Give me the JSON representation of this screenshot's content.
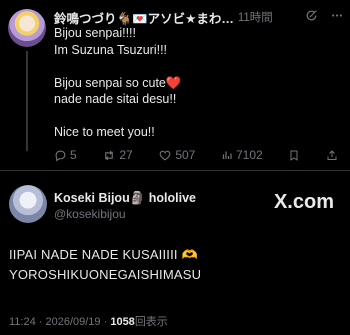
{
  "reply": {
    "display_name": "鈴鳴つづり🐐💌アソビ★まわ…",
    "time": "11時間",
    "lines": [
      "Bijou senpai!!!!",
      "Im Suzuna Tsuzuri!!!",
      "",
      "Bijou senpai so cute❤️",
      "nade nade sitai desu!!",
      "",
      "Nice to meet you!!"
    ],
    "stats": {
      "replies": "5",
      "reposts": "27",
      "likes": "507",
      "views": "7102"
    }
  },
  "quoted": {
    "display_name": "Koseki Bijou🗿 hololive",
    "handle": "@kosekibijou",
    "brand": "X.com",
    "lines": [
      "IIPAI NADE NADE KUSAIIIII 🫶",
      "YOROSHIKUONEGAISHIMASU"
    ],
    "footer_time": "11:24 · 2026/09/19 · ",
    "footer_count": "1058",
    "footer_suffix": "回表示"
  },
  "colors": {
    "background": "#000000",
    "text": "#e7e9ea",
    "muted": "#71767b",
    "divider": "#2f3336"
  },
  "icons": [
    "grok-icon",
    "more-icon",
    "reply-icon",
    "repost-icon",
    "like-icon",
    "views-icon",
    "bookmark-icon",
    "share-icon",
    "x-logo-icon"
  ]
}
